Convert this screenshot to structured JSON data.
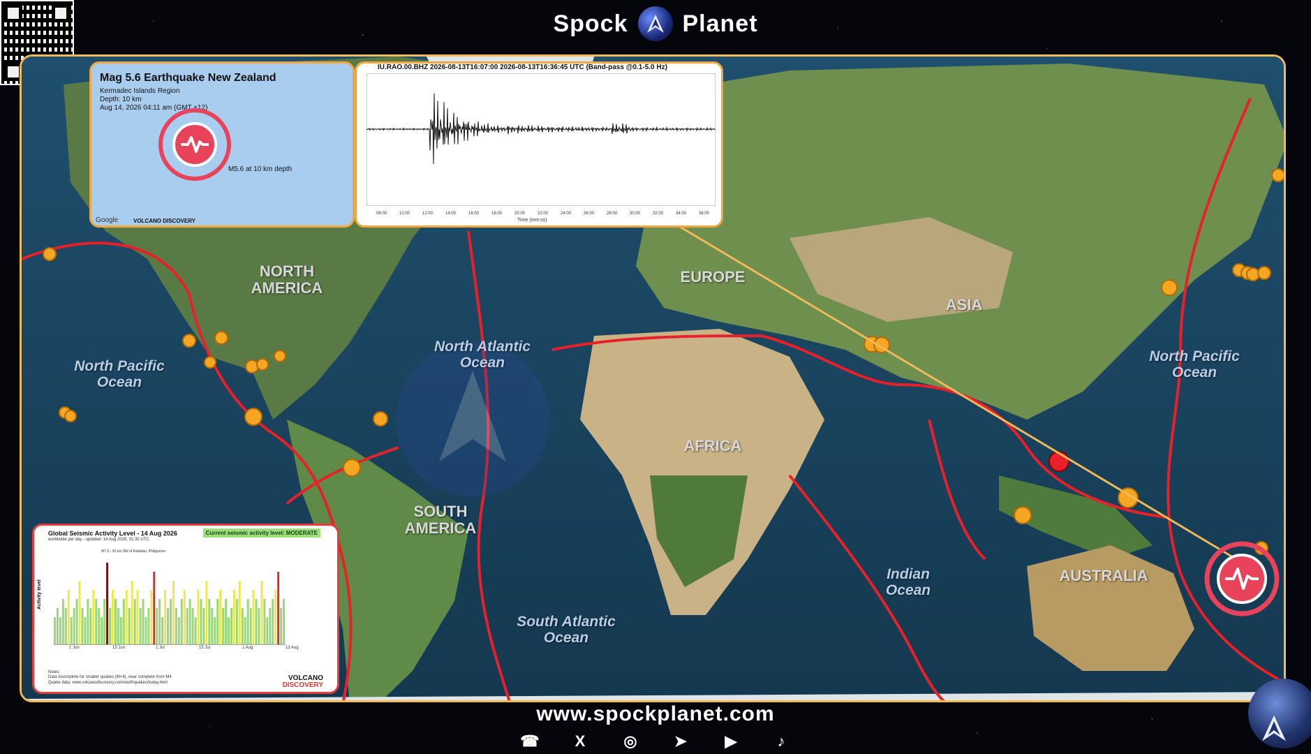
{
  "brand": {
    "left": "Spock",
    "right": "Planet",
    "website": "www.spockplanet.com"
  },
  "socials": [
    {
      "name": "whatsapp",
      "glyph": "☎"
    },
    {
      "name": "x",
      "glyph": "X"
    },
    {
      "name": "instagram",
      "glyph": "◎"
    },
    {
      "name": "telegram",
      "glyph": "➤"
    },
    {
      "name": "youtube",
      "glyph": "▶"
    },
    {
      "name": "tiktok",
      "glyph": "♪"
    }
  ],
  "map": {
    "continents": {
      "north_america": "NORTH AMERICA",
      "south_america": "SOUTH AMERICA",
      "europe": "EUROPE",
      "asia": "ASIA",
      "africa": "AFRICA",
      "australia": "AUSTRALIA"
    },
    "oceans": {
      "north_pacific_west": "North Pacific Ocean",
      "north_pacific_east": "North Pacific Ocean",
      "north_atlantic": "North Atlantic Ocean",
      "south_atlantic": "South Atlantic Ocean",
      "indian": "Indian Ocean"
    },
    "colors": {
      "plate_boundary": "#e8202a",
      "quake_marker": "#f5a623",
      "frame": "#f0b95a",
      "highlight": "#e9435b"
    }
  },
  "quake_panel": {
    "title": "Mag 5.6 Earthquake New Zealand",
    "region": "Kermadec Islands Region",
    "depth": "Depth: 10 km",
    "time": "Aug 14, 2026 04:11 am (GMT +12)",
    "marker_label": "M5.6 at 10 km depth",
    "google": "Google",
    "brand": "VOLCANO DISCOVERY"
  },
  "seismogram_panel": {
    "title": "IU.RAO.00.BHZ 2026-08-13T16:07:00  2026-08-13T16:36:45 UTC (Band-pass @0.1-5.0 Hz)",
    "xlabel": "Time (mm:ss)",
    "ticks": [
      "08:00",
      "10:00",
      "12:00",
      "14:00",
      "16:00",
      "18:00",
      "20:00",
      "22:00",
      "24:00",
      "26:00",
      "28:00",
      "30:00",
      "32:00",
      "34:00",
      "36:00"
    ]
  },
  "activity_panel": {
    "title": "Global Seismic Activity Level - 14 Aug 2026",
    "subtitle": "worldwide per day - updated: 14 Aug 2026, 01:30 UTC",
    "badge": "Current seismic activity level: MODERATE",
    "ylabel": "Activity level",
    "annotation": "M7.6 - 26 km SW of Kablalan, Philippines",
    "xticks": [
      "1 Jun",
      "15 Jun",
      "1 Jul",
      "15 Jul",
      "1 Aug",
      "13 Aug"
    ],
    "notes": [
      "Notes:",
      "Data incomplete for smaller quakes (M<4), near complete from M4",
      "Quake data: www.volcanodiscovery.com/earthquakes/today.html"
    ],
    "brand_top": "VOLCANO",
    "brand_bottom": "DISCOVERY"
  },
  "chart_data": {
    "type": "bar",
    "title": "Global Seismic Activity Level - 14 Aug 2026",
    "ylabel": "Activity level",
    "ylim": [
      0,
      10
    ],
    "values": [
      3,
      4,
      3,
      5,
      4,
      6,
      3,
      4,
      5,
      7,
      4,
      3,
      5,
      4,
      6,
      5,
      4,
      3,
      5,
      9,
      4,
      6,
      5,
      4,
      3,
      5,
      6,
      4,
      7,
      5,
      6,
      4,
      5,
      3,
      4,
      6,
      8,
      4,
      5,
      3,
      6,
      4,
      5,
      7,
      4,
      3,
      5,
      6,
      4,
      5,
      4,
      3,
      6,
      5,
      4,
      7,
      5,
      4,
      3,
      5,
      6,
      4,
      5,
      3,
      4,
      6,
      5,
      7,
      4,
      3,
      5,
      4,
      6,
      5,
      4,
      7,
      5,
      3,
      4,
      5,
      6,
      8,
      4,
      5
    ],
    "colors_by_level": {
      "low": "#9ad67a",
      "moderate": "#f0e84a",
      "high": "#d9302c",
      "very_high": "#6b1212"
    }
  }
}
